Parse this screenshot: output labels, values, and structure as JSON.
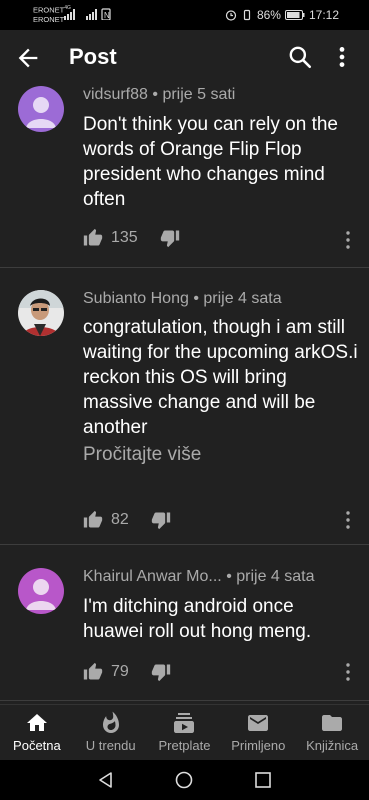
{
  "status_bar": {
    "carrier1": "ERONET",
    "network1": "4G",
    "carrier2": "ERONET",
    "battery": "86%",
    "time": "17:12"
  },
  "app_bar": {
    "title": "Post"
  },
  "comments": [
    {
      "author": "vidsurf88",
      "time": "prije 5 sati",
      "text": "Don't think you can rely on the words of Orange Flip Flop president who changes mind often",
      "likes": "135",
      "avatar_color": "#9c6bd6"
    },
    {
      "author": "Subianto Hong",
      "time": "prije 4 sata",
      "text": "congratulation, though i am still waiting for the upcoming arkOS.i reckon this OS will bring massive change and will be another",
      "read_more": "Pročitajte više",
      "likes": "82"
    },
    {
      "author": "Khairul Anwar Mo...",
      "time": "prije 4 sata",
      "text": "I'm ditching android once huawei roll out hong meng.",
      "likes": "79",
      "avatar_color": "#b857c9"
    }
  ],
  "separator": "•",
  "bottom_nav": [
    {
      "label": "Početna",
      "icon": "home-icon",
      "active": true
    },
    {
      "label": "U trendu",
      "icon": "flame-icon"
    },
    {
      "label": "Pretplate",
      "icon": "subscriptions-icon"
    },
    {
      "label": "Primljeno",
      "icon": "mail-icon"
    },
    {
      "label": "Knjižnica",
      "icon": "folder-icon"
    }
  ],
  "colors": {
    "background": "#212121",
    "text_secondary": "#aaaaaa",
    "divider": "#3d3d3d"
  }
}
